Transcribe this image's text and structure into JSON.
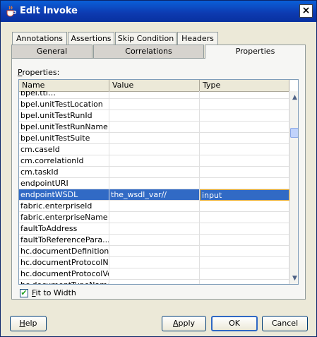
{
  "window": {
    "title": "Edit Invoke",
    "close_glyph": "×",
    "app_icon": "java-cup-icon"
  },
  "tabs": {
    "row1": [
      "Annotations",
      "Assertions",
      "Skip Condition",
      "Headers"
    ],
    "row2": [
      "General",
      "Correlations",
      "Properties"
    ],
    "active": "Properties"
  },
  "properties": {
    "label": "Properties:",
    "label_rest": "roperties:",
    "label_mnemonic": "P",
    "columns": [
      "Name",
      "Value",
      "Type"
    ],
    "partial_top_row": "bpel.ttl…",
    "rows": [
      {
        "name": "bpel.unitTestLocation",
        "value": "",
        "type": ""
      },
      {
        "name": "bpel.unitTestRunId",
        "value": "",
        "type": ""
      },
      {
        "name": "bpel.unitTestRunName",
        "value": "",
        "type": ""
      },
      {
        "name": "bpel.unitTestSuite",
        "value": "",
        "type": ""
      },
      {
        "name": "cm.caseId",
        "value": "",
        "type": ""
      },
      {
        "name": "cm.correlationId",
        "value": "",
        "type": ""
      },
      {
        "name": "cm.taskId",
        "value": "",
        "type": ""
      },
      {
        "name": "endpointURI",
        "value": "",
        "type": ""
      },
      {
        "name": "endpointWSDL",
        "value": "the_wsdl_var//",
        "type": "input",
        "selected": true
      },
      {
        "name": "fabric.enterpriseId",
        "value": "",
        "type": ""
      },
      {
        "name": "fabric.enterpriseName",
        "value": "",
        "type": ""
      },
      {
        "name": "faultToAddress",
        "value": "",
        "type": ""
      },
      {
        "name": "faultToReferencePara...",
        "value": "",
        "type": ""
      },
      {
        "name": "hc.documentDefinition...",
        "value": "",
        "type": ""
      },
      {
        "name": "hc.documentProtocolN...",
        "value": "",
        "type": ""
      },
      {
        "name": "hc.documentProtocolVe...",
        "value": "",
        "type": ""
      },
      {
        "name": "hc.documentTypeName",
        "value": "",
        "type": ""
      }
    ]
  },
  "fit_to_width": {
    "label": "Fit to Width",
    "label_mnemonic": "F",
    "label_rest": "it to Width",
    "checked": true,
    "check_glyph": "✔"
  },
  "buttons": {
    "help": {
      "mnemonic": "H",
      "rest": "elp"
    },
    "apply": {
      "mnemonic": "A",
      "rest": "pply"
    },
    "ok": "OK",
    "cancel": "Cancel"
  },
  "colors": {
    "selection": "#316ac5",
    "titlebar": "#0a5fd8",
    "dialog_bg": "#ece9d8"
  }
}
